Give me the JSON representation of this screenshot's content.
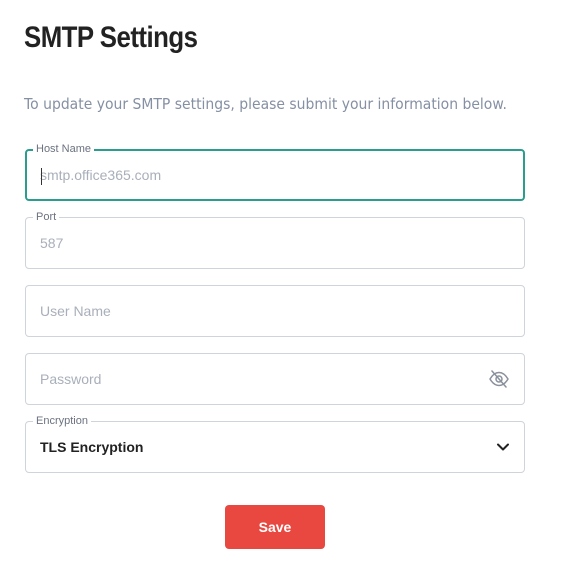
{
  "page": {
    "title": "SMTP Settings",
    "subtitle": "To update your SMTP settings, please submit your information below."
  },
  "form": {
    "host": {
      "label": "Host Name",
      "value": "",
      "placeholder": "smtp.office365.com",
      "focused": true
    },
    "port": {
      "label": "Port",
      "value": "",
      "placeholder": "587"
    },
    "username": {
      "value": "",
      "placeholder": "User Name"
    },
    "password": {
      "value": "",
      "placeholder": "Password",
      "icon": "eye-slash-icon"
    },
    "encryption": {
      "label": "Encryption",
      "selected": "TLS Encryption",
      "icon": "chevron-down-icon"
    }
  },
  "actions": {
    "save_label": "Save"
  },
  "colors": {
    "accent_focus": "#2a9d8f",
    "save_button": "#e8483f",
    "border": "#cfd3da",
    "placeholder": "#a9afba",
    "subtitle": "#8590a3"
  }
}
